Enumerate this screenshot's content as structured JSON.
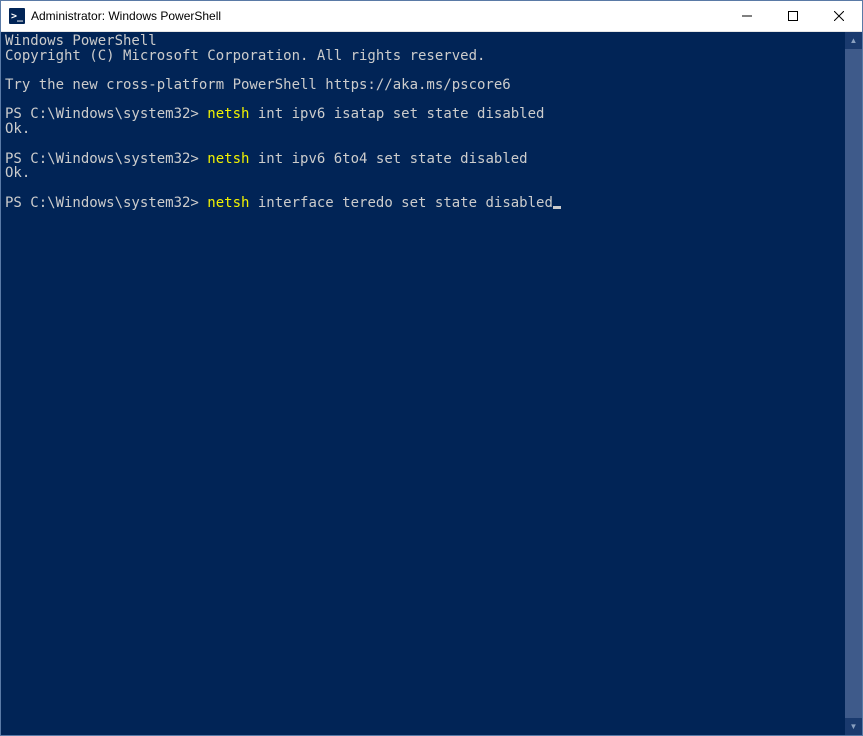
{
  "window": {
    "title": "Administrator: Windows PowerShell"
  },
  "terminal": {
    "header1": "Windows PowerShell",
    "header2": "Copyright (C) Microsoft Corporation. All rights reserved.",
    "tryMsg": "Try the new cross-platform PowerShell https://aka.ms/pscore6",
    "prompt": "PS C:\\Windows\\system32> ",
    "cmdHighlight": "netsh",
    "cmd1Rest": " int ipv6 isatap set state disabled",
    "ok": "Ok.",
    "cmd2Rest": " int ipv6 6to4 set state disabled",
    "cmd3Rest": " interface teredo set state disabled"
  }
}
